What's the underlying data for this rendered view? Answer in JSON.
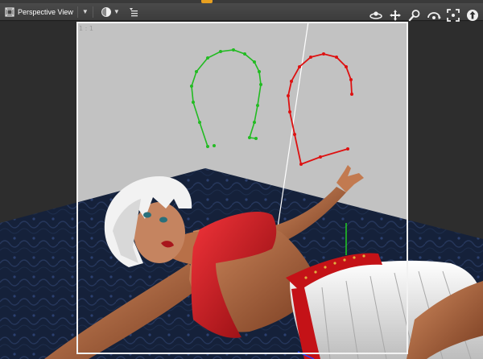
{
  "toolbar": {
    "view_title": "Perspective View",
    "view_icon": "perspective-view-icon",
    "view_dropdown_icon": "chevron-down-icon",
    "shading_icon": "sphere-shading-icon",
    "shading_dropdown_icon": "chevron-down-icon",
    "view_menu_icon": "view-menu-icon",
    "nav_tools": [
      {
        "name": "orbit-icon"
      },
      {
        "name": "pan-icon"
      },
      {
        "name": "zoom-icon"
      },
      {
        "name": "bank-icon"
      },
      {
        "name": "frame-icon"
      },
      {
        "name": "aux-view-icon"
      }
    ]
  },
  "viewport": {
    "frame_label": "1 : 1",
    "colors": {
      "background": "#c0c0c0",
      "floor": "#14203a",
      "frame": "#f2f2f2",
      "green_curve": "#22bb22",
      "red_curve": "#dd1111",
      "top_red": "#c8141a",
      "skirt_white": "#eeeeee",
      "skin": "#b06a45",
      "hair": "#f2f2f2"
    }
  }
}
